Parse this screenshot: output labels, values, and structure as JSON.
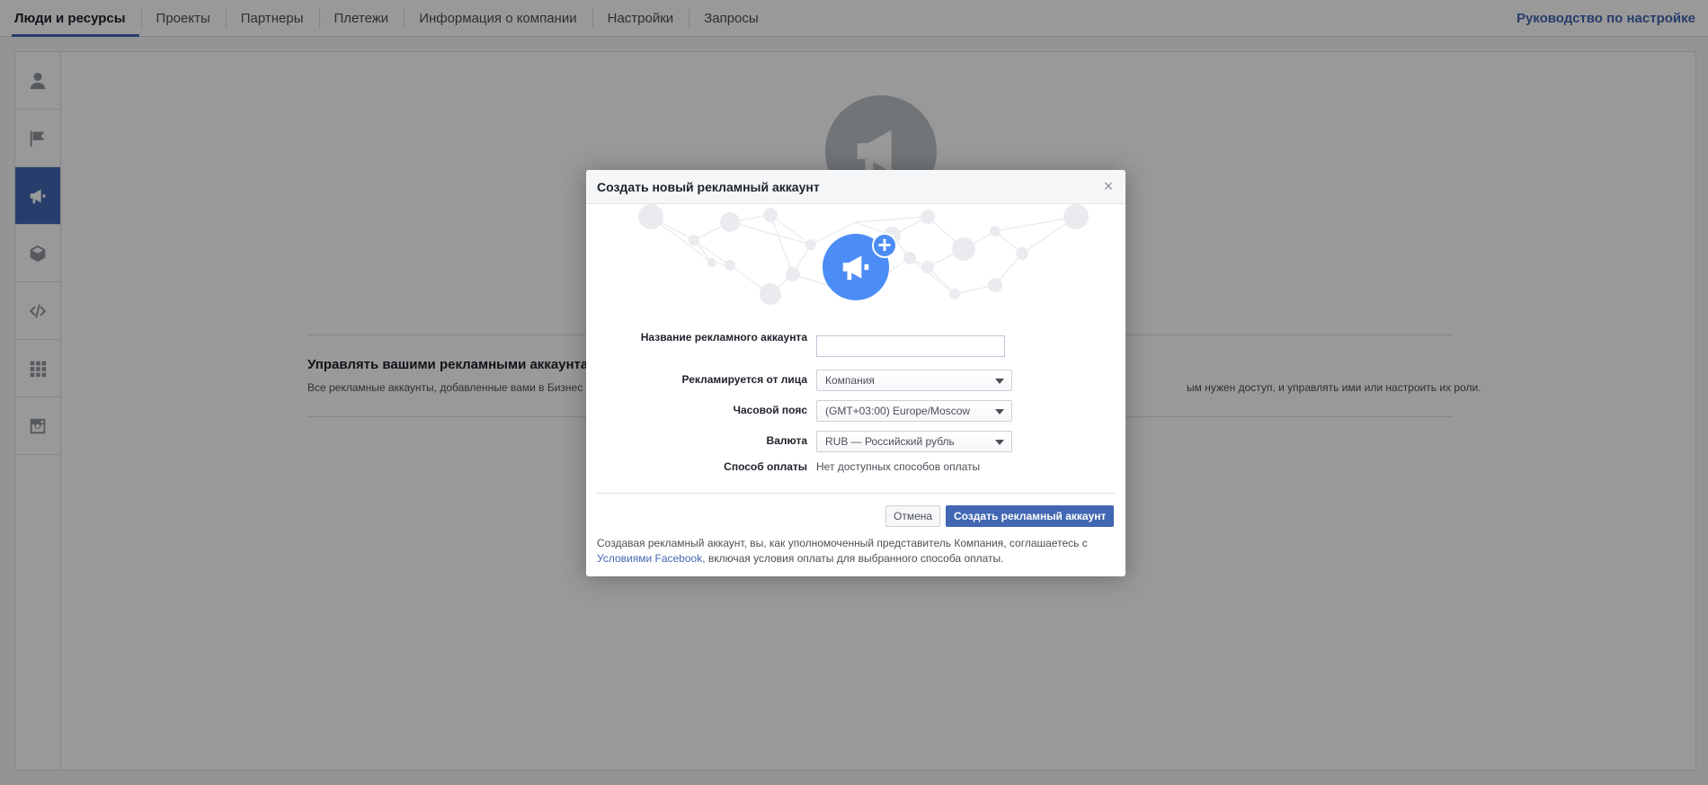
{
  "nav": {
    "tabs": [
      {
        "label": "Люди и ресурсы",
        "active": true
      },
      {
        "label": "Проекты"
      },
      {
        "label": "Партнеры"
      },
      {
        "label": "Плетежи"
      },
      {
        "label": "Информация о компании"
      },
      {
        "label": "Настройки"
      },
      {
        "label": "Запросы"
      }
    ],
    "guide_link": "Руководство по настройке"
  },
  "sidebar": {
    "items": [
      {
        "icon": "person-icon"
      },
      {
        "icon": "flag-icon"
      },
      {
        "icon": "megaphone-icon",
        "active": true
      },
      {
        "icon": "cube-icon"
      },
      {
        "icon": "code-icon"
      },
      {
        "icon": "grid-icon"
      },
      {
        "icon": "instagram-icon"
      }
    ]
  },
  "main": {
    "section_title": "Управлять вашими рекламными аккаунтами",
    "section_desc_left": "Все рекламные аккаунты, добавленные вами в Бизнес",
    "section_desc_right": "ым нужен доступ, и управлять ими или настроить их роли."
  },
  "modal": {
    "title": "Создать новый рекламный аккаунт",
    "close": "×",
    "hero_plus": "+",
    "fields": {
      "account_name": {
        "label": "Название рекламного аккаунта",
        "value": ""
      },
      "advertised_as": {
        "label": "Рекламируется от лица",
        "value": "Компания"
      },
      "timezone": {
        "label": "Часовой пояс",
        "value": "(GMT+03:00) Europe/Moscow"
      },
      "currency": {
        "label": "Валюта",
        "value": "RUB — Российский рубль"
      },
      "payment_method": {
        "label": "Способ оплаты",
        "value": "Нет доступных способов оплаты"
      }
    },
    "buttons": {
      "cancel": "Отмена",
      "create": "Создать рекламный аккаунт"
    },
    "footer": {
      "text_before": "Создавая рекламный аккаунт, вы, как уполномоченный представитель Компания, соглашаетесь с",
      "link": "Условиями Facebook",
      "text_after": ", включая условия оплаты для выбранного способа оплаты."
    }
  },
  "colors": {
    "accent": "#4267b2",
    "hero": "#4c8cf5",
    "overlay": "rgba(0,0,0,0.4)"
  }
}
